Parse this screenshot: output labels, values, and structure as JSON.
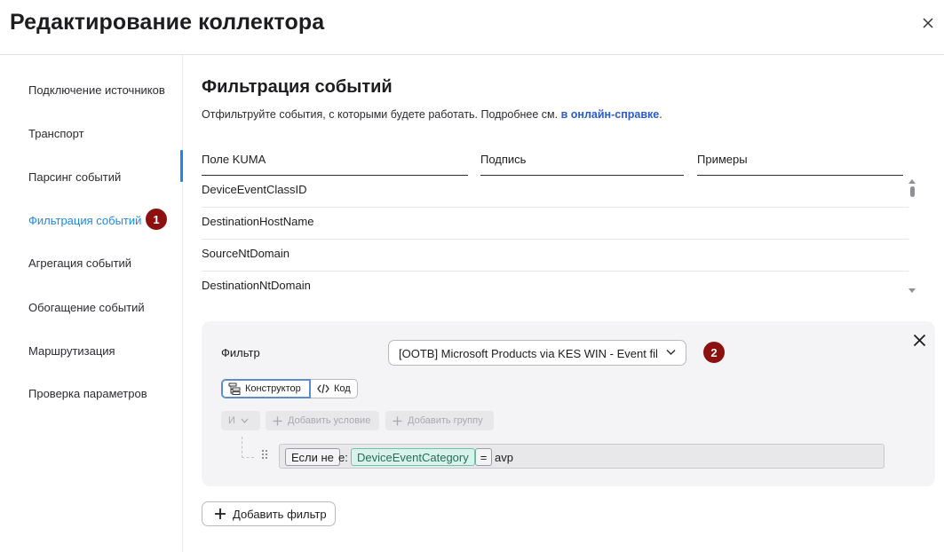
{
  "window": {
    "title": "Редактирование коллектора"
  },
  "sidebar": {
    "items": [
      {
        "label": "Подключение источников",
        "active": false
      },
      {
        "label": "Транспорт",
        "active": false
      },
      {
        "label": "Парсинг событий",
        "active": false
      },
      {
        "label": "Фильтрация событий",
        "active": true
      },
      {
        "label": "Агрегация событий",
        "active": false
      },
      {
        "label": "Обогащение событий",
        "active": false
      },
      {
        "label": "Маршрутизация",
        "active": false
      },
      {
        "label": "Проверка параметров",
        "active": false
      }
    ],
    "active_badge": "1"
  },
  "main": {
    "title": "Фильтрация событий",
    "description": "Отфильтруйте события, с которыми будете работать. Подробнее см. ",
    "help_link": "в онлайн-справке",
    "description_end": "."
  },
  "table": {
    "columns": [
      "Поле KUMA",
      "Подпись",
      "Примеры"
    ],
    "rows": [
      "DeviceEventClassID",
      "DestinationHostName",
      "SourceNtDomain",
      "DestinationNtDomain"
    ]
  },
  "filter": {
    "label": "Фильтр",
    "selected": "[OOTB] Microsoft Products via KES WIN - Event filter",
    "badge": "2",
    "tabs": {
      "builder": "Конструктор",
      "code": "Код"
    },
    "logic_operator": "И",
    "add_condition": "Добавить условие",
    "add_group": "Добавить группу",
    "condition": {
      "negation": "Если не",
      "prefix": "e:",
      "field": "DeviceEventCategory",
      "operator": "=",
      "value": "avp"
    }
  },
  "footer": {
    "add_filter": "Добавить фильтр"
  },
  "colors": {
    "accent": "#1e88e5",
    "badge": "#8c1010",
    "link": "#2a5cc9",
    "field_chip": "#d8f3ec"
  }
}
